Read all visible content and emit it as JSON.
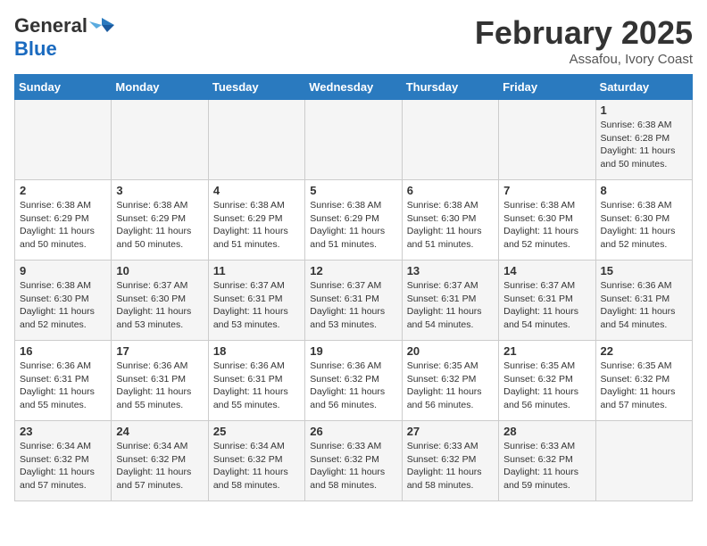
{
  "header": {
    "logo_general": "General",
    "logo_blue": "Blue",
    "month_title": "February 2025",
    "location": "Assafou, Ivory Coast"
  },
  "days_of_week": [
    "Sunday",
    "Monday",
    "Tuesday",
    "Wednesday",
    "Thursday",
    "Friday",
    "Saturday"
  ],
  "weeks": [
    [
      {
        "day": "",
        "info": ""
      },
      {
        "day": "",
        "info": ""
      },
      {
        "day": "",
        "info": ""
      },
      {
        "day": "",
        "info": ""
      },
      {
        "day": "",
        "info": ""
      },
      {
        "day": "",
        "info": ""
      },
      {
        "day": "1",
        "info": "Sunrise: 6:38 AM\nSunset: 6:28 PM\nDaylight: 11 hours\nand 50 minutes."
      }
    ],
    [
      {
        "day": "2",
        "info": "Sunrise: 6:38 AM\nSunset: 6:29 PM\nDaylight: 11 hours\nand 50 minutes."
      },
      {
        "day": "3",
        "info": "Sunrise: 6:38 AM\nSunset: 6:29 PM\nDaylight: 11 hours\nand 50 minutes."
      },
      {
        "day": "4",
        "info": "Sunrise: 6:38 AM\nSunset: 6:29 PM\nDaylight: 11 hours\nand 51 minutes."
      },
      {
        "day": "5",
        "info": "Sunrise: 6:38 AM\nSunset: 6:29 PM\nDaylight: 11 hours\nand 51 minutes."
      },
      {
        "day": "6",
        "info": "Sunrise: 6:38 AM\nSunset: 6:30 PM\nDaylight: 11 hours\nand 51 minutes."
      },
      {
        "day": "7",
        "info": "Sunrise: 6:38 AM\nSunset: 6:30 PM\nDaylight: 11 hours\nand 52 minutes."
      },
      {
        "day": "8",
        "info": "Sunrise: 6:38 AM\nSunset: 6:30 PM\nDaylight: 11 hours\nand 52 minutes."
      }
    ],
    [
      {
        "day": "9",
        "info": "Sunrise: 6:38 AM\nSunset: 6:30 PM\nDaylight: 11 hours\nand 52 minutes."
      },
      {
        "day": "10",
        "info": "Sunrise: 6:37 AM\nSunset: 6:30 PM\nDaylight: 11 hours\nand 53 minutes."
      },
      {
        "day": "11",
        "info": "Sunrise: 6:37 AM\nSunset: 6:31 PM\nDaylight: 11 hours\nand 53 minutes."
      },
      {
        "day": "12",
        "info": "Sunrise: 6:37 AM\nSunset: 6:31 PM\nDaylight: 11 hours\nand 53 minutes."
      },
      {
        "day": "13",
        "info": "Sunrise: 6:37 AM\nSunset: 6:31 PM\nDaylight: 11 hours\nand 54 minutes."
      },
      {
        "day": "14",
        "info": "Sunrise: 6:37 AM\nSunset: 6:31 PM\nDaylight: 11 hours\nand 54 minutes."
      },
      {
        "day": "15",
        "info": "Sunrise: 6:36 AM\nSunset: 6:31 PM\nDaylight: 11 hours\nand 54 minutes."
      }
    ],
    [
      {
        "day": "16",
        "info": "Sunrise: 6:36 AM\nSunset: 6:31 PM\nDaylight: 11 hours\nand 55 minutes."
      },
      {
        "day": "17",
        "info": "Sunrise: 6:36 AM\nSunset: 6:31 PM\nDaylight: 11 hours\nand 55 minutes."
      },
      {
        "day": "18",
        "info": "Sunrise: 6:36 AM\nSunset: 6:31 PM\nDaylight: 11 hours\nand 55 minutes."
      },
      {
        "day": "19",
        "info": "Sunrise: 6:36 AM\nSunset: 6:32 PM\nDaylight: 11 hours\nand 56 minutes."
      },
      {
        "day": "20",
        "info": "Sunrise: 6:35 AM\nSunset: 6:32 PM\nDaylight: 11 hours\nand 56 minutes."
      },
      {
        "day": "21",
        "info": "Sunrise: 6:35 AM\nSunset: 6:32 PM\nDaylight: 11 hours\nand 56 minutes."
      },
      {
        "day": "22",
        "info": "Sunrise: 6:35 AM\nSunset: 6:32 PM\nDaylight: 11 hours\nand 57 minutes."
      }
    ],
    [
      {
        "day": "23",
        "info": "Sunrise: 6:34 AM\nSunset: 6:32 PM\nDaylight: 11 hours\nand 57 minutes."
      },
      {
        "day": "24",
        "info": "Sunrise: 6:34 AM\nSunset: 6:32 PM\nDaylight: 11 hours\nand 57 minutes."
      },
      {
        "day": "25",
        "info": "Sunrise: 6:34 AM\nSunset: 6:32 PM\nDaylight: 11 hours\nand 58 minutes."
      },
      {
        "day": "26",
        "info": "Sunrise: 6:33 AM\nSunset: 6:32 PM\nDaylight: 11 hours\nand 58 minutes."
      },
      {
        "day": "27",
        "info": "Sunrise: 6:33 AM\nSunset: 6:32 PM\nDaylight: 11 hours\nand 58 minutes."
      },
      {
        "day": "28",
        "info": "Sunrise: 6:33 AM\nSunset: 6:32 PM\nDaylight: 11 hours\nand 59 minutes."
      },
      {
        "day": "",
        "info": ""
      }
    ]
  ]
}
